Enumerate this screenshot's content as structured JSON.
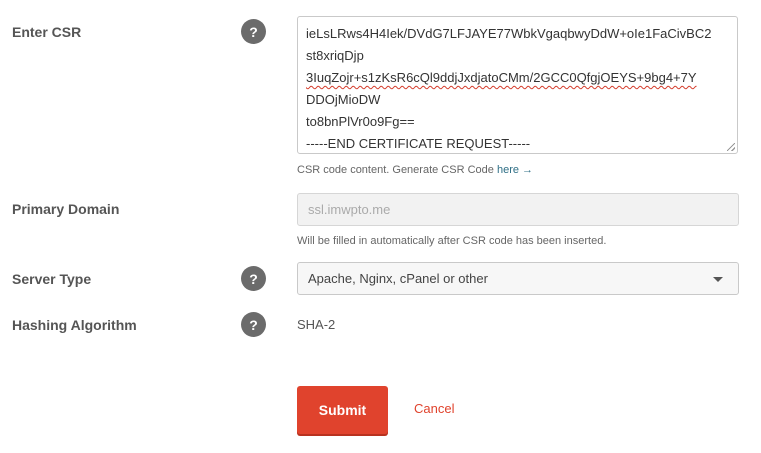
{
  "form": {
    "csr": {
      "label": "Enter CSR",
      "help": "?",
      "lines": [
        "ieLsLRws4H4Iek/DVdG7LFJAYE77WbkVgaqbwyDdW+oIe1FaCivBC2",
        "st8xriqDjp",
        "3IuqZojr+s1zKsR6cQl9ddjJxdjatoCMm/2GCC0QfgjOEYS+9bg4+7Y",
        "DDOjMioDW",
        "to8bnPlVr0o9Fg==",
        "-----END CERTIFICATE REQUEST-----"
      ],
      "hint_text": "CSR code content. Generate CSR Code ",
      "hint_link": "here →"
    },
    "primary_domain": {
      "label": "Primary Domain",
      "placeholder": "ssl.imwpto.me",
      "hint": "Will be filled in automatically after CSR code has been inserted."
    },
    "server_type": {
      "label": "Server Type",
      "help": "?",
      "selected": "Apache, Nginx, cPanel or other"
    },
    "hashing": {
      "label": "Hashing Algorithm",
      "help": "?",
      "value": "SHA-2"
    },
    "submit_label": "Submit",
    "cancel_label": "Cancel"
  },
  "colors": {
    "accent": "#e0432d",
    "help_icon_bg": "#6b6b6b",
    "link": "#2f6f86"
  }
}
